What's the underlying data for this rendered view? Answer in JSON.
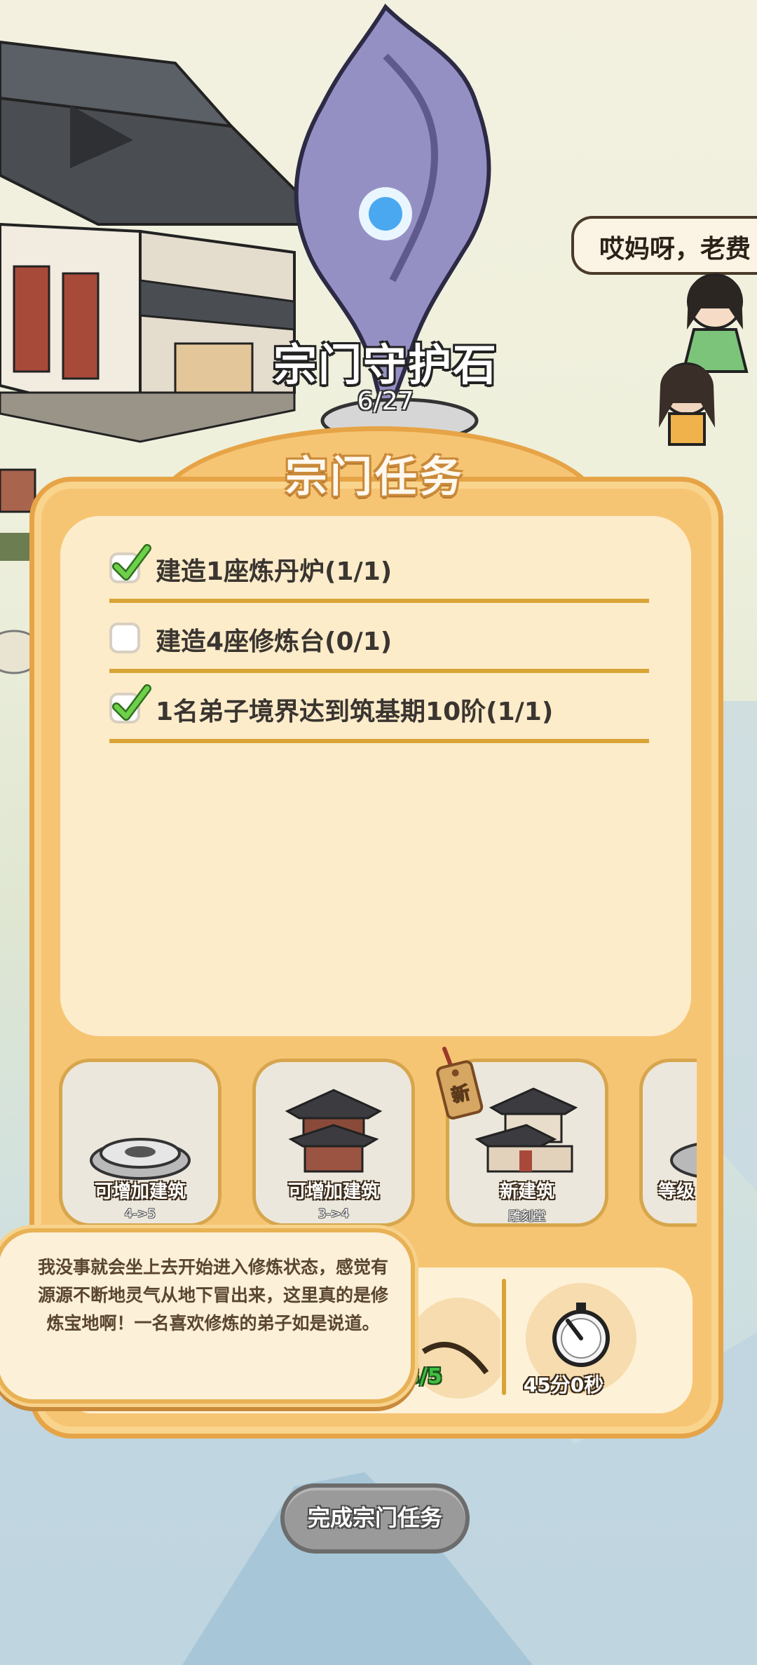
{
  "scene": {
    "shrine_name": "宗门守护石",
    "shrine_progress": "6/27",
    "speech_text": "哎妈呀，老费"
  },
  "panel": {
    "title": "宗门任务",
    "tasks": [
      {
        "label": "建造1座炼丹炉(1/1)",
        "done": true
      },
      {
        "label": "建造4座修炼台(0/1)",
        "done": false
      },
      {
        "label": "1名弟子境界达到筑基期10阶(1/1)",
        "done": true
      }
    ],
    "rewards": [
      {
        "caption": "可增加建筑",
        "sub": "4->5",
        "icon": "cultivation-platform-icon"
      },
      {
        "caption": "可增加建筑",
        "sub": "3->4",
        "icon": "pavilion-icon"
      },
      {
        "caption": "新建筑",
        "sub": "雕刻堂",
        "icon": "carving-hall-icon",
        "tag": "新"
      },
      {
        "caption": "等级",
        "sub": "",
        "icon": "level-icon"
      }
    ],
    "progress_text": "3/5",
    "timer_text": "45分0秒"
  },
  "dialog": {
    "text": "我没事就会坐上去开始进入修炼状态，感觉有源源不断地灵气从地下冒出来，这里真的是修炼宝地啊！一名喜欢修炼的弟子如是说道。"
  },
  "button": {
    "label": "完成宗门任务"
  },
  "colors": {
    "panel": "#f6c574",
    "panel_border": "#e6a447",
    "task_box": "#fdecca",
    "divider": "#d9a436",
    "check": "#5cc23c",
    "button_disabled": "#9a9a9a"
  }
}
